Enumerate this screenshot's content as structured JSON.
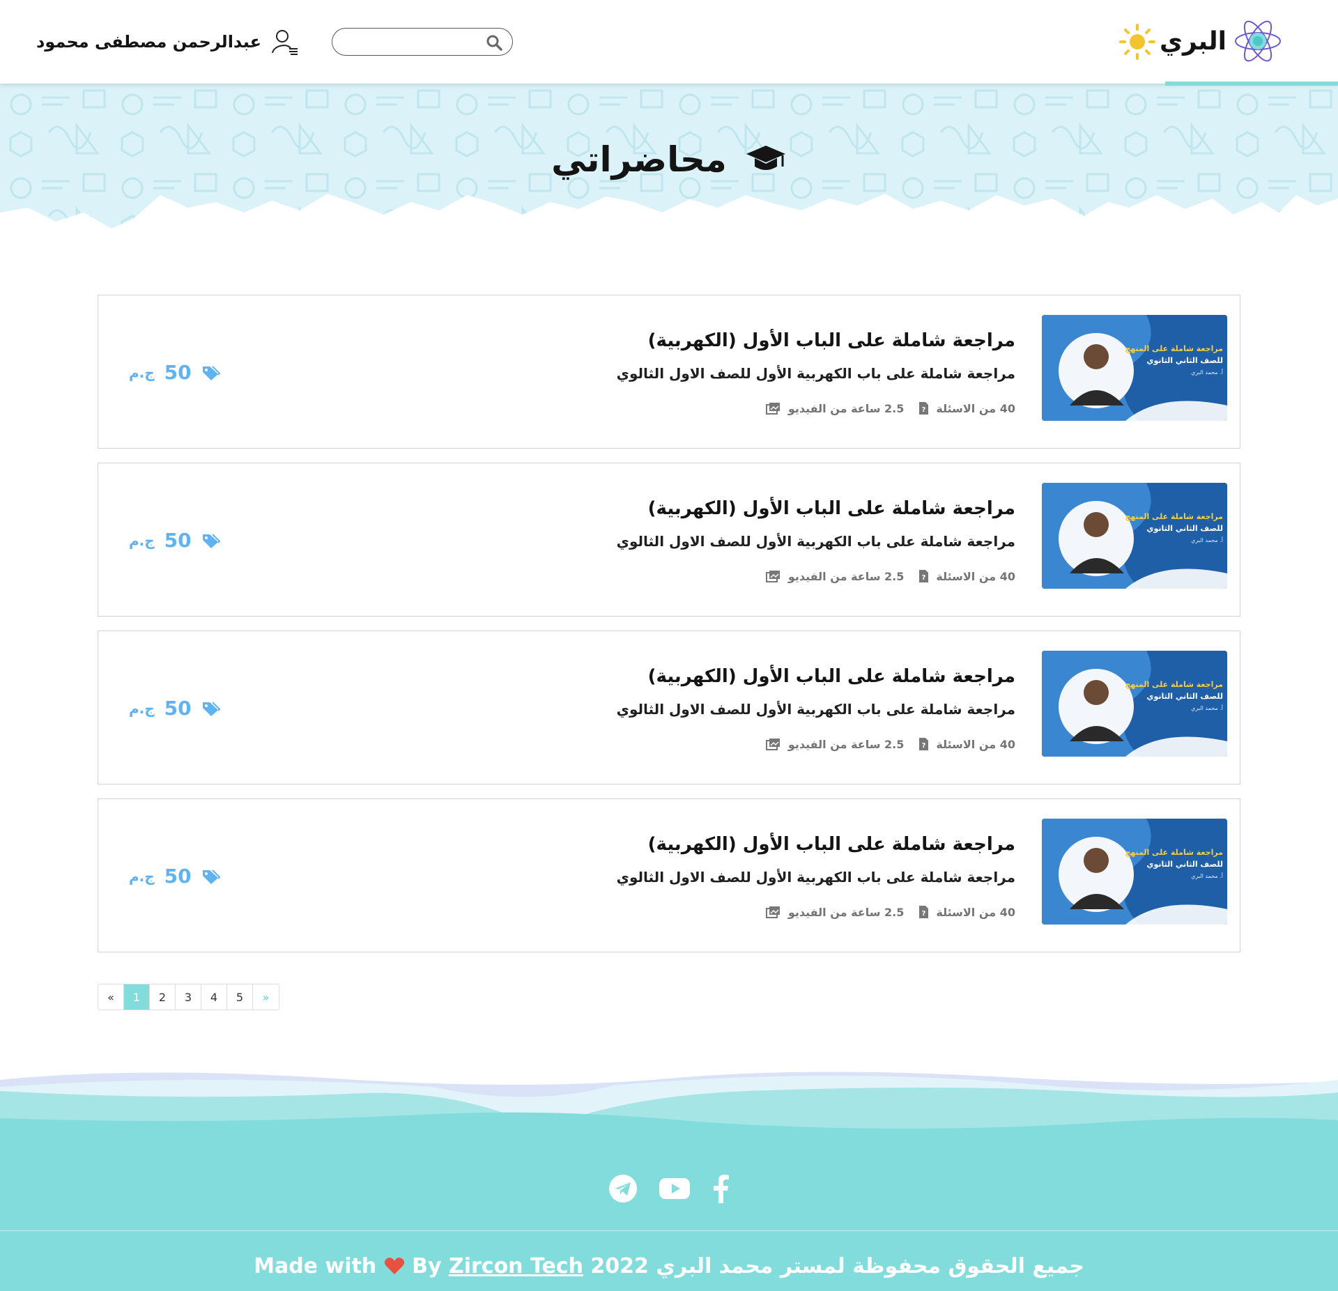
{
  "brand": {
    "name": "البري",
    "accent": "#83dcdc",
    "sun_color": "#f4c430"
  },
  "header": {
    "search": {
      "placeholder": "",
      "value": ""
    },
    "user_name": "عبدالرحمن مصطفى محمود"
  },
  "hero": {
    "title": "محاضراتي"
  },
  "courses": [
    {
      "title": "مراجعة شاملة على الباب الأول (الكهربية)",
      "subtitle": "مراجعة شاملة على باب الكهربية الأول للصف الاول الثالوي",
      "video": "2.5 ساعة من الفيديو",
      "questions": "40 من الاسئلة",
      "price": "50",
      "currency": "ج.م"
    },
    {
      "title": "مراجعة شاملة على الباب الأول (الكهربية)",
      "subtitle": "مراجعة شاملة على باب الكهربية الأول للصف الاول الثالوي",
      "video": "2.5 ساعة من الفيديو",
      "questions": "40 من الاسئلة",
      "price": "50",
      "currency": "ج.م"
    },
    {
      "title": "مراجعة شاملة على الباب الأول (الكهربية)",
      "subtitle": "مراجعة شاملة على باب الكهربية الأول للصف الاول الثالوي",
      "video": "2.5 ساعة من الفيديو",
      "questions": "40 من الاسئلة",
      "price": "50",
      "currency": "ج.م"
    },
    {
      "title": "مراجعة شاملة على الباب الأول (الكهربية)",
      "subtitle": "مراجعة شاملة على باب الكهربية الأول للصف الاول الثالوي",
      "video": "2.5 ساعة من الفيديو",
      "questions": "40 من الاسئلة",
      "price": "50",
      "currency": "ج.م"
    }
  ],
  "thumbnail": {
    "headline": "مراجعة شاملة على المنهج",
    "line2": "للصف الثاني الثانوي",
    "teacher": "أ. محمد البري"
  },
  "pagination": {
    "prev": "«",
    "pages": [
      "1",
      "2",
      "3",
      "4",
      "5"
    ],
    "active": "1",
    "next": "»"
  },
  "footer": {
    "social": [
      "telegram-icon",
      "youtube-icon",
      "facebook-icon"
    ],
    "copyright": "جميع الحقوق محفوظة لمستر محمد البري 2022",
    "made_with": "Made with",
    "by": "By",
    "company": "Zircon Tech"
  }
}
